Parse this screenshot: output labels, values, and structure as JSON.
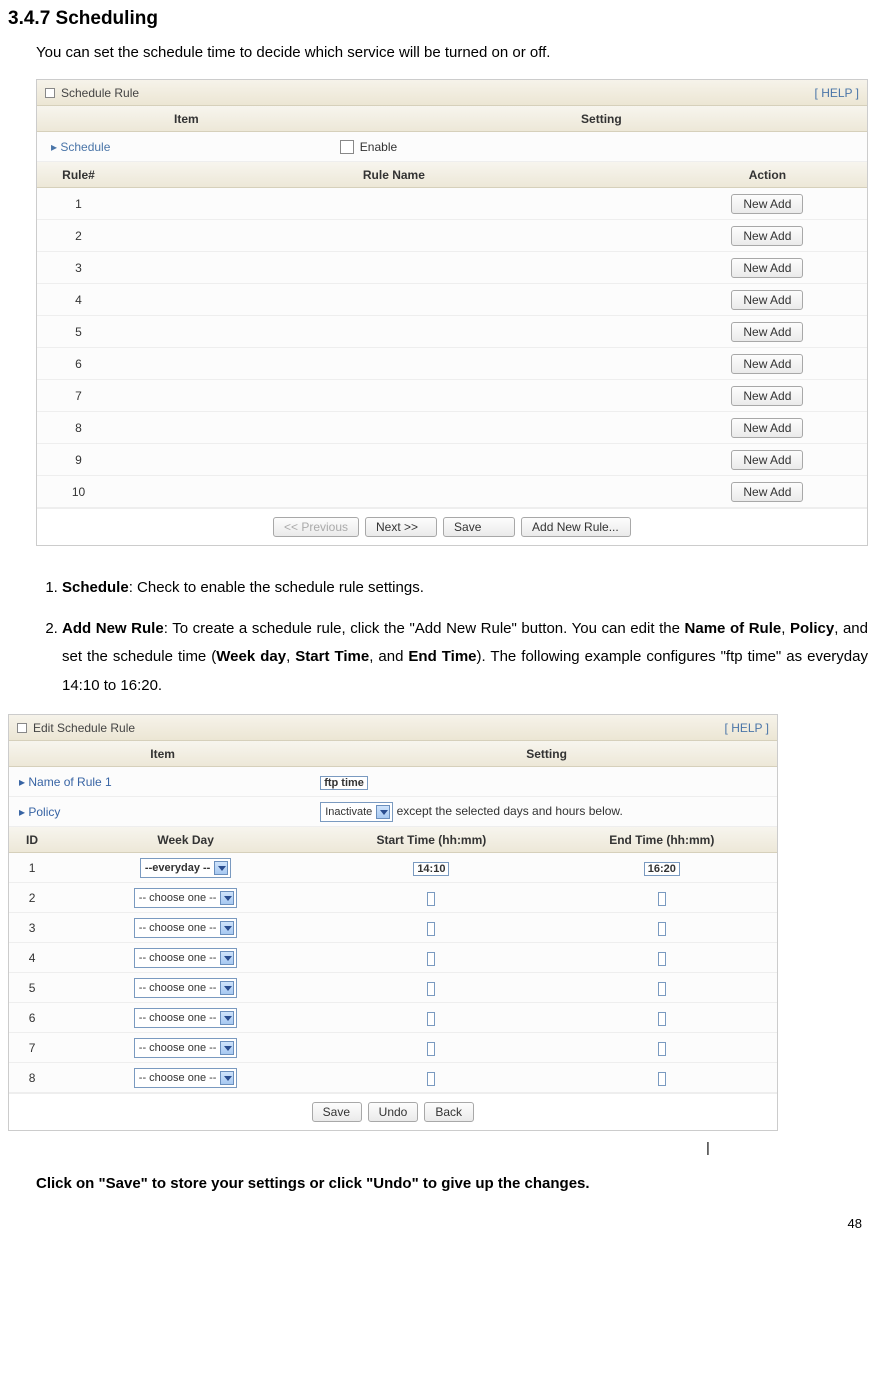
{
  "heading": "3.4.7 Scheduling",
  "intro": "You can set the schedule time to decide which service will be turned on or off.",
  "panel1": {
    "title": "Schedule Rule",
    "help": "[ HELP ]",
    "hdr_item": "Item",
    "hdr_setting": "Setting",
    "schedule_label": "Schedule",
    "enable_label": "Enable",
    "rule_hdr_num": "Rule#",
    "rule_hdr_name": "Rule Name",
    "rule_hdr_action": "Action",
    "rows": [
      "1",
      "2",
      "3",
      "4",
      "5",
      "6",
      "7",
      "8",
      "9",
      "10"
    ],
    "new_add": "New Add",
    "btn_prev": "<< Previous",
    "btn_next": "Next >>",
    "btn_save": "Save",
    "btn_addnew": "Add New Rule..."
  },
  "list": {
    "item1_b": "Schedule",
    "item1_rest": ": Check to enable the schedule rule settings.",
    "item2_b": "Add New Rule",
    "item2_rest_a": ": To create a schedule rule, click the \"Add New Rule\" button. You can edit the ",
    "item2_b2": "Name of Rule",
    "item2_sep1": ", ",
    "item2_b3": "Policy",
    "item2_rest_b": ", and set the schedule time (",
    "item2_b4": "Week day",
    "item2_sep2": ", ",
    "item2_b5": "Start Time",
    "item2_sep3": ", and ",
    "item2_b6": "End Time",
    "item2_rest_c": "). The following example configures \"ftp time\" as everyday 14:10 to 16:20."
  },
  "panel2": {
    "title": "Edit Schedule Rule",
    "help": "[ HELP ]",
    "hdr_item": "Item",
    "hdr_setting": "Setting",
    "name_label": "Name of Rule 1",
    "name_value": "ftp time",
    "policy_label": "Policy",
    "policy_value": "Inactivate",
    "policy_suffix": "except the selected days and hours below.",
    "th_id": "ID",
    "th_wd": "Week Day",
    "th_st": "Start Time (hh:mm)",
    "th_et": "End Time (hh:mm)",
    "rows": [
      {
        "id": "1",
        "wd": "--everyday     --",
        "st": "14:10",
        "et": "16:20"
      },
      {
        "id": "2",
        "wd": "-- choose one --",
        "st": "",
        "et": ""
      },
      {
        "id": "3",
        "wd": "-- choose one --",
        "st": "",
        "et": ""
      },
      {
        "id": "4",
        "wd": "-- choose one --",
        "st": "",
        "et": ""
      },
      {
        "id": "5",
        "wd": "-- choose one --",
        "st": "",
        "et": ""
      },
      {
        "id": "6",
        "wd": "-- choose one --",
        "st": "",
        "et": ""
      },
      {
        "id": "7",
        "wd": "-- choose one --",
        "st": "",
        "et": ""
      },
      {
        "id": "8",
        "wd": "-- choose one --",
        "st": "",
        "et": ""
      }
    ],
    "btn_save": "Save",
    "btn_undo": "Undo",
    "btn_back": "Back"
  },
  "pipe": "|",
  "closing": "Click on \"Save\" to store your settings or click \"Undo\" to give up the changes.",
  "pagenum": "48"
}
